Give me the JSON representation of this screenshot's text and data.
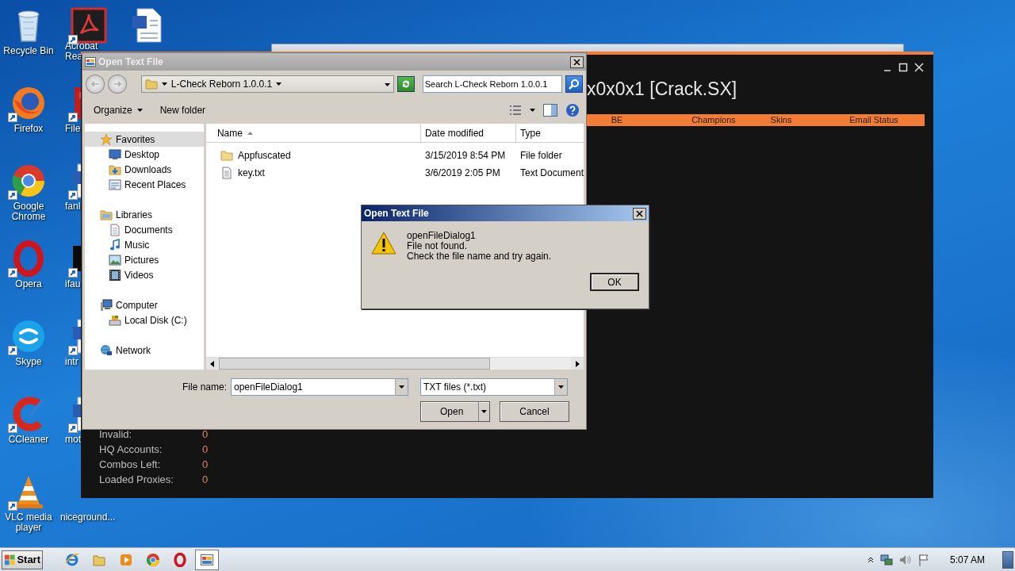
{
  "desktop": {
    "icons": [
      {
        "label": "Recycle Bin",
        "kind": "recycle",
        "shortcut": false
      },
      {
        "label": "Firefox",
        "kind": "firefox",
        "shortcut": true
      },
      {
        "label": "Google Chrome",
        "kind": "chrome",
        "shortcut": true
      },
      {
        "label": "Opera",
        "kind": "opera",
        "shortcut": true
      },
      {
        "label": "Skype",
        "kind": "skype",
        "shortcut": true
      },
      {
        "label": "CCleaner",
        "kind": "ccleaner",
        "shortcut": true
      },
      {
        "label": "VLC media player",
        "kind": "vlc",
        "shortcut": true
      }
    ],
    "icons_column_2": [
      {
        "label": "Acrobat Rea",
        "kind": "acrobat",
        "shortcut": true
      },
      {
        "label": "File",
        "kind": "filezilla",
        "shortcut": true
      },
      {
        "label": "fanl",
        "kind": "word",
        "shortcut": true
      },
      {
        "label": "ifau",
        "kind": "blank",
        "shortcut": true
      },
      {
        "label": "intr",
        "kind": "word",
        "shortcut": true
      },
      {
        "label": "mot",
        "kind": "word",
        "shortcut": true
      },
      {
        "label": "niceground...",
        "kind": "hidden"
      }
    ],
    "icons_column_3": [
      {
        "kind": "word",
        "shortcut": false
      }
    ]
  },
  "app_window": {
    "title": "x0x0x1 [Crack.SX]",
    "columns": [
      "BE",
      "Champions",
      "Skins",
      "Email Status"
    ],
    "stats": [
      {
        "label": "Invalid:",
        "value": "0"
      },
      {
        "label": "HQ Accounts:",
        "value": "0"
      },
      {
        "label": "Combos Left:",
        "value": "0"
      },
      {
        "label": "Loaded Proxies:",
        "value": "0"
      }
    ]
  },
  "file_dialog": {
    "title": "Open Text File",
    "address": "L-Check Reborn 1.0.0.1",
    "search": {
      "placeholder": "Search L-Check Reborn 1.0.0.1"
    },
    "toolbar": [
      {
        "label": "Organize",
        "dropdown": true
      },
      {
        "label": "New folder",
        "dropdown": false
      }
    ],
    "nav": [
      {
        "label": "Favorites",
        "kind": "star",
        "selected": true,
        "children": [
          {
            "label": "Desktop",
            "kind": "desktop",
            "selected": false
          },
          {
            "label": "Downloads",
            "kind": "downloads",
            "selected": false
          },
          {
            "label": "Recent Places",
            "kind": "recent",
            "selected": false
          }
        ]
      },
      {
        "label": "Libraries",
        "kind": "library",
        "selected": false,
        "children": [
          {
            "label": "Documents",
            "kind": "document",
            "selected": false
          },
          {
            "label": "Music",
            "kind": "music",
            "selected": false
          },
          {
            "label": "Pictures",
            "kind": "pictures",
            "selected": false
          },
          {
            "label": "Videos",
            "kind": "videos",
            "selected": false
          }
        ]
      },
      {
        "label": "Computer",
        "kind": "computer",
        "selected": false,
        "children": [
          {
            "label": "Local Disk (C:)",
            "kind": "disk",
            "selected": false
          }
        ]
      },
      {
        "label": "Network",
        "kind": "network",
        "selected": false
      }
    ],
    "columns": [
      {
        "label": "Name",
        "sorted": true
      },
      {
        "label": "Date modified",
        "sorted": false
      },
      {
        "label": "Type",
        "sorted": false
      }
    ],
    "files": [
      {
        "name": "Appfuscated",
        "date": "3/15/2019 8:54 PM",
        "type": "File folder",
        "kind": "folder",
        "selected": false
      },
      {
        "name": "key.txt",
        "date": "3/6/2019 2:05 PM",
        "type": "Text Document",
        "kind": "text",
        "selected": false
      }
    ],
    "file_name": {
      "label": "File name:",
      "value": "openFileDialog1"
    },
    "filter": "TXT files (*.txt)",
    "buttons": [
      {
        "label": "Open",
        "split": true
      },
      {
        "label": "Cancel",
        "split": false
      }
    ]
  },
  "message_box": {
    "title": "Open Text File",
    "kind": "warning",
    "lines": [
      "openFileDialog1",
      "File not found.",
      "Check the file name and try again."
    ],
    "button": "OK"
  },
  "taskbar": {
    "start": "Start",
    "apps": [
      {
        "kind": "ie",
        "active": false
      },
      {
        "kind": "explorer",
        "active": false
      },
      {
        "kind": "media",
        "active": false
      },
      {
        "kind": "chrome",
        "active": false
      },
      {
        "kind": "opera",
        "active": false
      },
      {
        "kind": "app",
        "active": true
      }
    ],
    "clock": "5:07 AM"
  }
}
